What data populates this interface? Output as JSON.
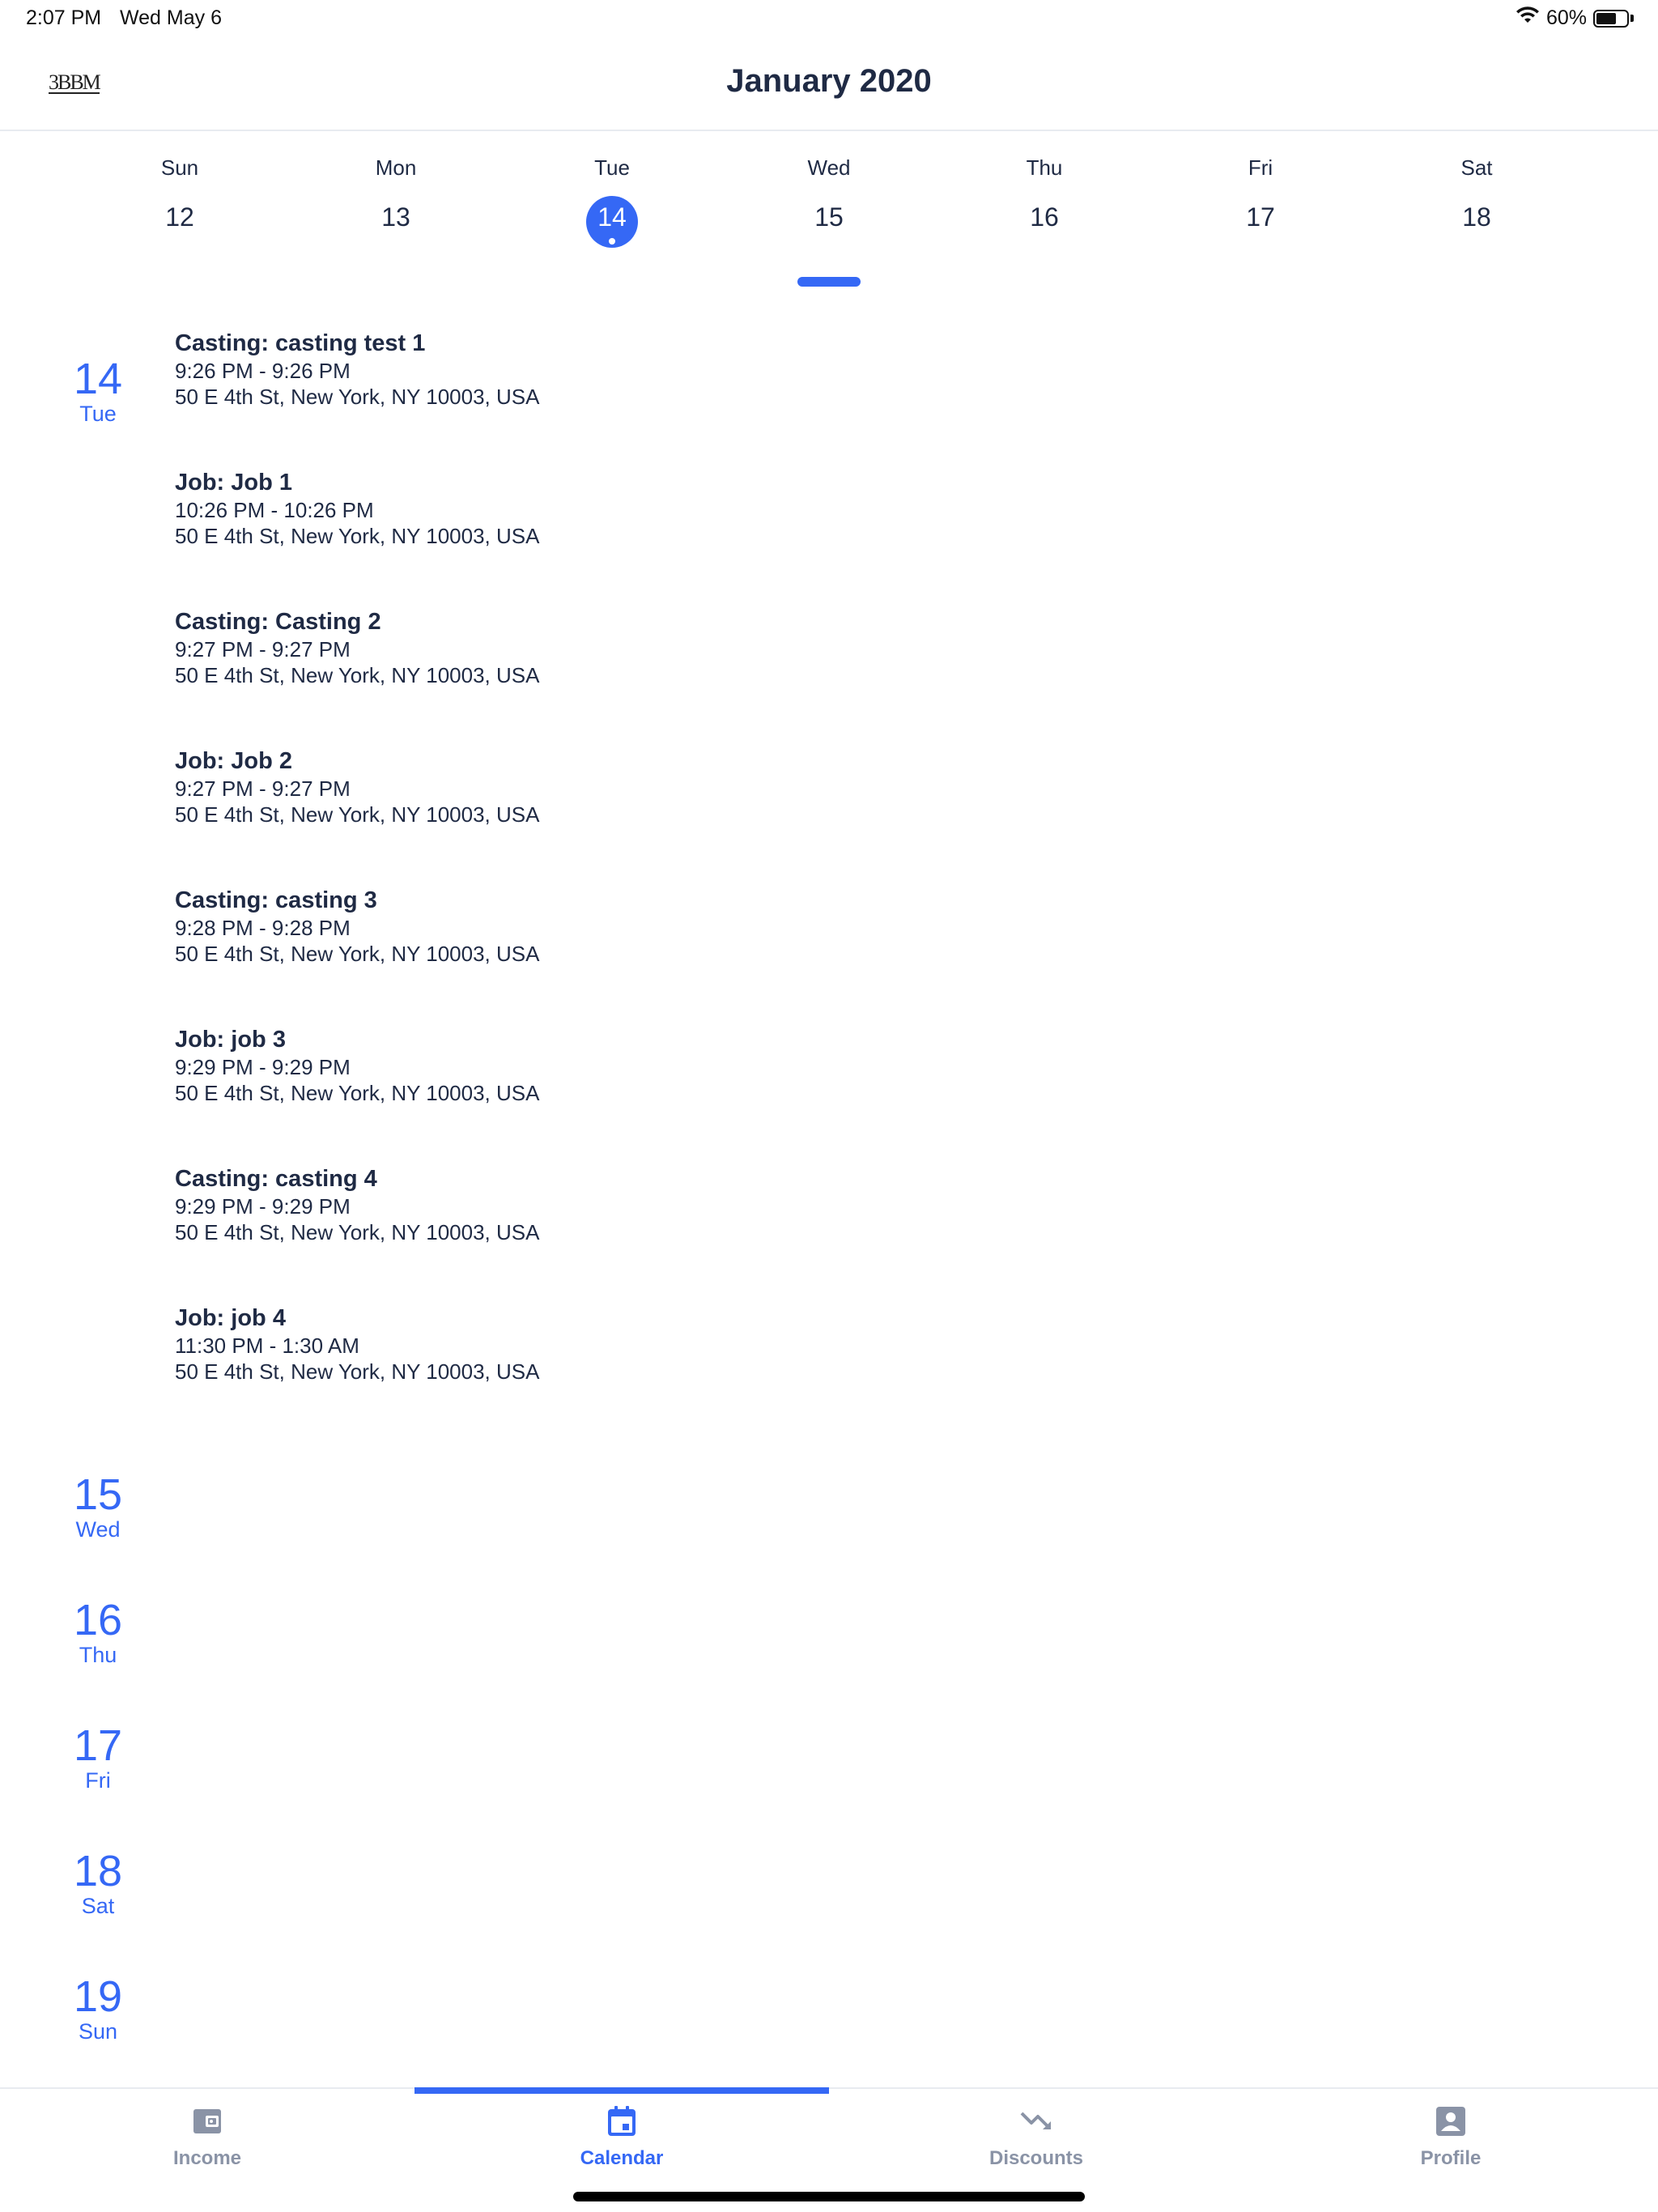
{
  "status_bar": {
    "time": "2:07 PM",
    "date": "Wed May 6",
    "battery": "60%"
  },
  "header": {
    "logo": "3BBM",
    "title": "January 2020"
  },
  "week": {
    "days": [
      {
        "name": "Sun",
        "number": "12",
        "selected": false
      },
      {
        "name": "Mon",
        "number": "13",
        "selected": false
      },
      {
        "name": "Tue",
        "number": "14",
        "selected": true
      },
      {
        "name": "Wed",
        "number": "15",
        "selected": false
      },
      {
        "name": "Thu",
        "number": "16",
        "selected": false
      },
      {
        "name": "Fri",
        "number": "17",
        "selected": false
      },
      {
        "name": "Sat",
        "number": "18",
        "selected": false
      }
    ]
  },
  "agenda": {
    "dates": [
      {
        "number": "14",
        "weekday": "Tue"
      },
      {
        "number": "15",
        "weekday": "Wed"
      },
      {
        "number": "16",
        "weekday": "Thu"
      },
      {
        "number": "17",
        "weekday": "Fri"
      },
      {
        "number": "18",
        "weekday": "Sat"
      },
      {
        "number": "19",
        "weekday": "Sun"
      }
    ],
    "events": [
      {
        "title": "Casting: casting test 1",
        "time": "9:26 PM - 9:26 PM",
        "address": "50 E 4th St, New York, NY 10003, USA"
      },
      {
        "title": "Job: Job 1",
        "time": "10:26 PM - 10:26 PM",
        "address": "50 E 4th St, New York, NY 10003, USA"
      },
      {
        "title": "Casting: Casting 2",
        "time": "9:27 PM - 9:27 PM",
        "address": "50 E 4th St, New York, NY 10003, USA"
      },
      {
        "title": "Job: Job 2",
        "time": "9:27 PM - 9:27 PM",
        "address": "50 E 4th St, New York, NY 10003, USA"
      },
      {
        "title": "Casting: casting 3",
        "time": "9:28 PM - 9:28 PM",
        "address": "50 E 4th St, New York, NY 10003, USA"
      },
      {
        "title": "Job: job 3",
        "time": "9:29 PM - 9:29 PM",
        "address": "50 E 4th St, New York, NY 10003, USA"
      },
      {
        "title": "Casting: casting 4",
        "time": "9:29 PM - 9:29 PM",
        "address": "50 E 4th St, New York, NY 10003, USA"
      },
      {
        "title": "Job: job 4",
        "time": "11:30 PM - 1:30 AM",
        "address": "50 E 4th St, New York, NY 10003, USA"
      }
    ]
  },
  "tabs": [
    {
      "label": "Income",
      "icon": "wallet-icon",
      "active": false
    },
    {
      "label": "Calendar",
      "icon": "calendar-icon",
      "active": true
    },
    {
      "label": "Discounts",
      "icon": "trending-down-icon",
      "active": false
    },
    {
      "label": "Profile",
      "icon": "profile-icon",
      "active": false
    }
  ],
  "colors": {
    "accent": "#3568f5",
    "text": "#1f2a44",
    "inactive": "#8a93a6"
  }
}
